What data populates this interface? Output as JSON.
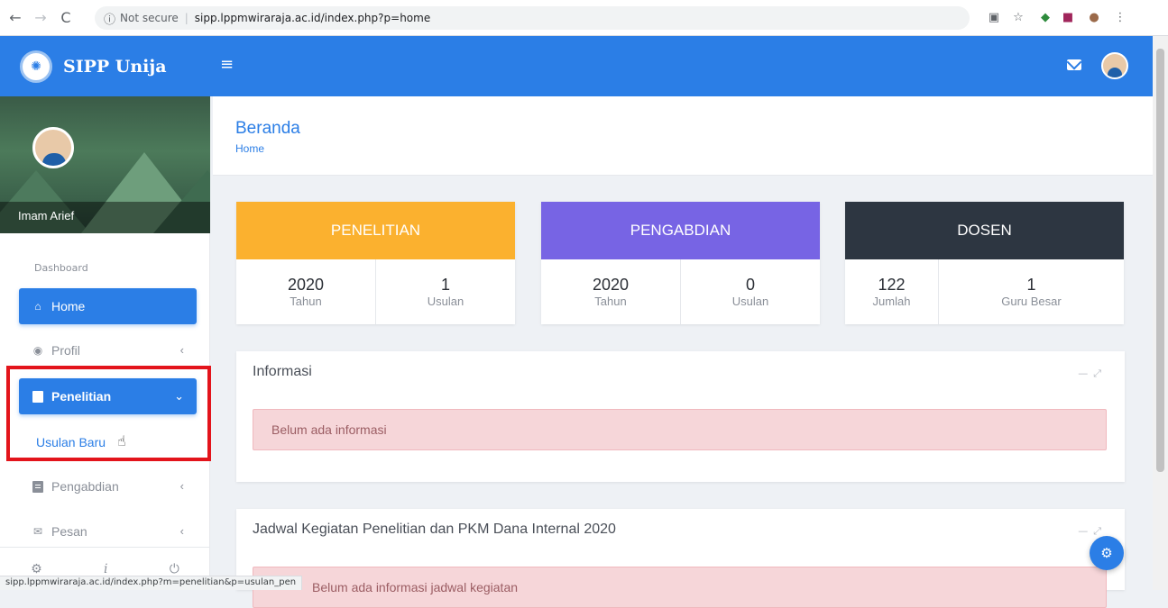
{
  "browser": {
    "not_secure": "Not secure",
    "url": "sipp.lppmwiraraja.ac.id/index.php?p=home",
    "status_url": "sipp.lppmwiraraja.ac.id/index.php?m=penelitian&p=usulan_pen"
  },
  "app": {
    "brand": "SIPP Unija"
  },
  "sidebar": {
    "user_name": "Imam Arief",
    "section": "Dashboard",
    "items": [
      {
        "label": "Home",
        "icon": "home-icon"
      },
      {
        "label": "Profil",
        "icon": "user-circle-icon"
      },
      {
        "label": "Penelitian",
        "icon": "document-icon"
      },
      {
        "label": "Pengabdian",
        "icon": "document-icon"
      },
      {
        "label": "Pesan",
        "icon": "mail-icon"
      }
    ],
    "submenu": {
      "label": "Usulan Baru"
    }
  },
  "page": {
    "title": "Beranda",
    "breadcrumb": "Home"
  },
  "stats": [
    {
      "title": "PENELITIAN",
      "color": "#fbb12f",
      "cells": [
        {
          "value": "2020",
          "label": "Tahun"
        },
        {
          "value": "1",
          "label": "Usulan"
        }
      ]
    },
    {
      "title": "PENGABDIAN",
      "color": "#7764e4",
      "cells": [
        {
          "value": "2020",
          "label": "Tahun"
        },
        {
          "value": "0",
          "label": "Usulan"
        }
      ]
    },
    {
      "title": "DOSEN",
      "color": "#2d3641",
      "cells": [
        {
          "value": "122",
          "label": "Jumlah"
        },
        {
          "value": "1",
          "label": "Guru Besar"
        }
      ]
    }
  ],
  "panels": {
    "info": {
      "title": "Informasi",
      "alert": "Belum ada informasi"
    },
    "schedule": {
      "title": "Jadwal Kegiatan Penelitian dan PKM Dana Internal 2020",
      "alert": "Belum ada informasi jadwal kegiatan"
    }
  }
}
